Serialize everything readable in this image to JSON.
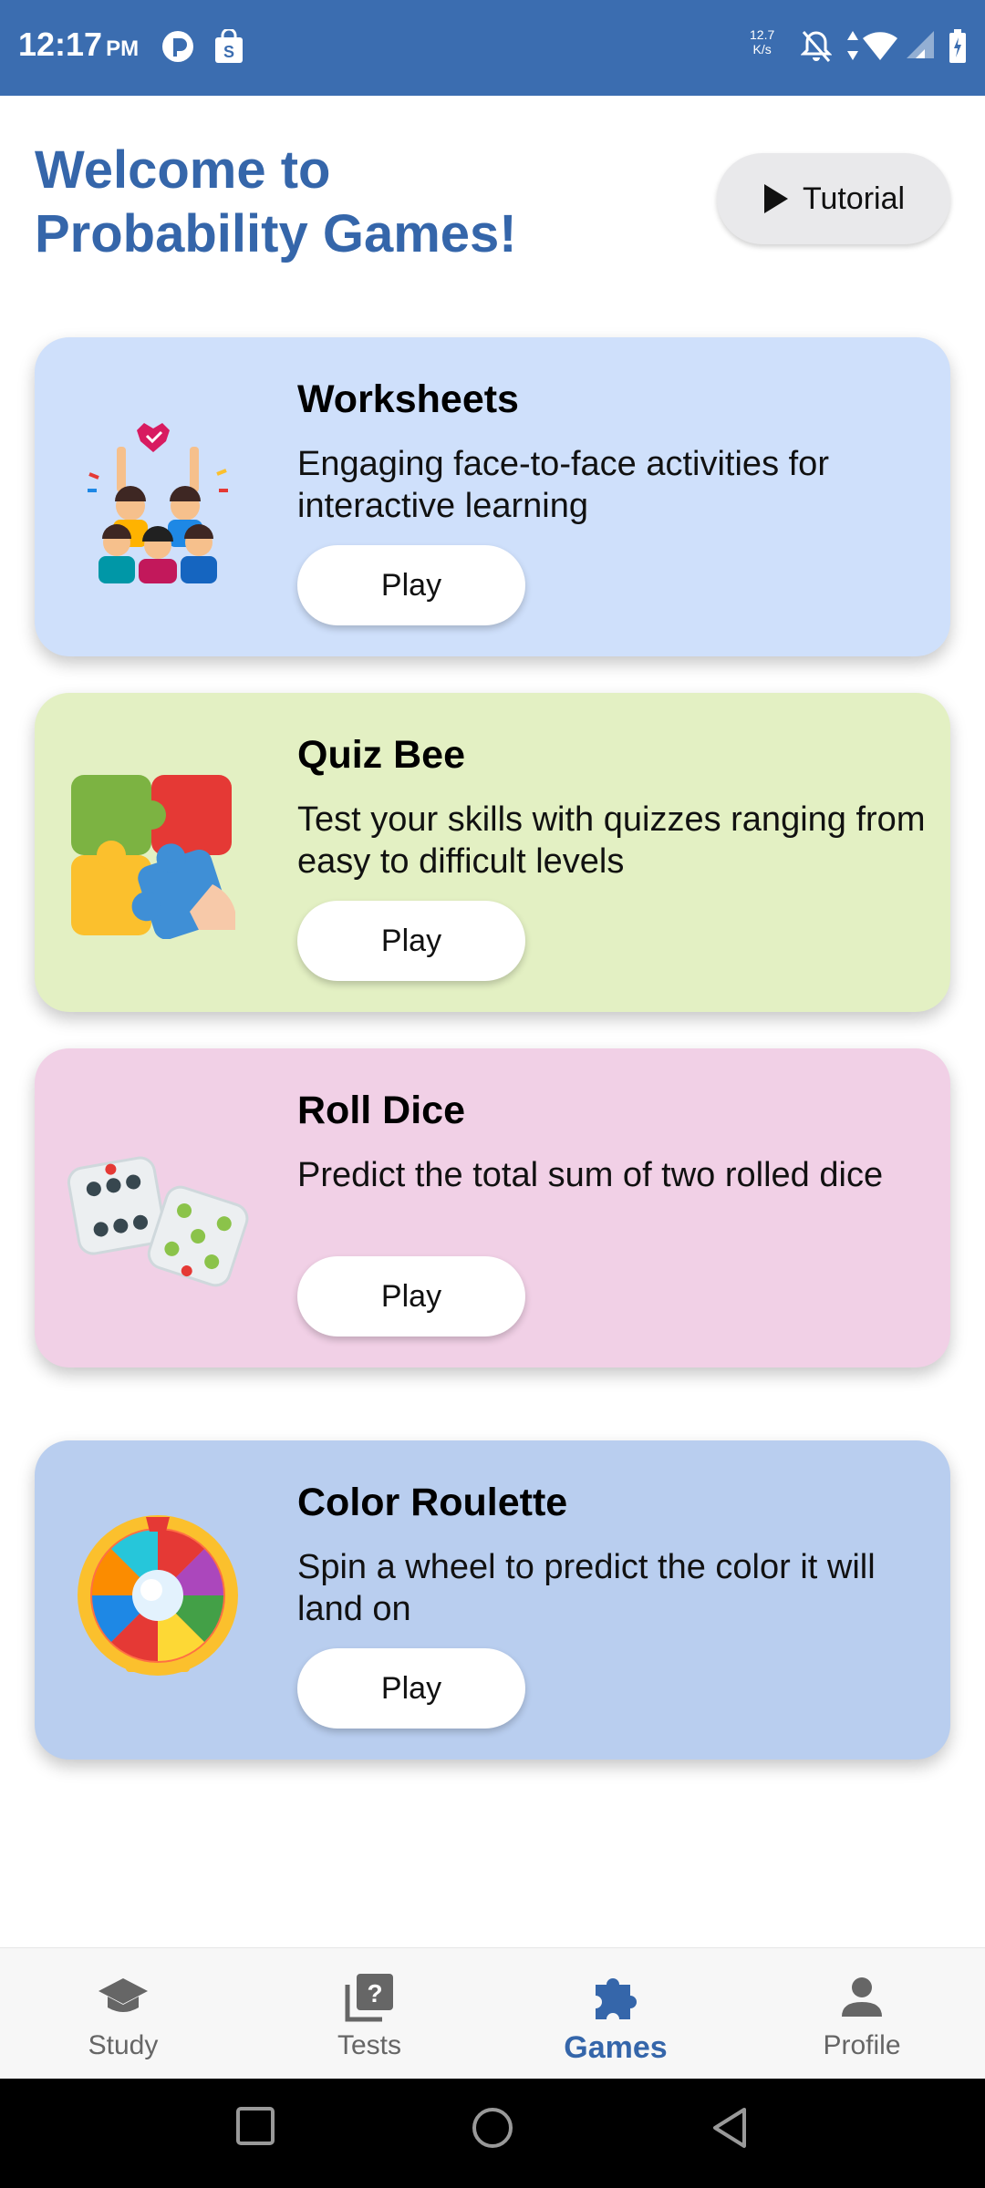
{
  "status_bar": {
    "time": "12:17",
    "ampm": "PM",
    "net_speed_value": "12.7",
    "net_speed_unit": "K/s",
    "icons": [
      "app-icon",
      "shopping-bag-icon",
      "notifications-off-icon",
      "data-arrows-icon",
      "wifi-icon",
      "signal-icon",
      "battery-icon"
    ]
  },
  "header": {
    "title_line1": "Welcome to",
    "title_line2": "Probability Games!",
    "tutorial_label": "Tutorial"
  },
  "games": [
    {
      "title": "Worksheets",
      "description": "Engaging face-to-face activities for interactive learning",
      "button": "Play",
      "bg": "#cfe0fb",
      "icon": "group-people-icon"
    },
    {
      "title": "Quiz Bee",
      "description": "Test your skills with quizzes ranging from easy to difficult levels",
      "button": "Play",
      "bg": "#e3f0c3",
      "icon": "puzzle-icon"
    },
    {
      "title": "Roll Dice",
      "description": "Predict the total sum of two rolled dice",
      "button": "Play",
      "bg": "#f1d0e6",
      "icon": "dice-icon"
    },
    {
      "title": "Color Roulette",
      "description": "Spin a wheel to predict the color it will land on",
      "button": "Play",
      "bg": "#b9ceef",
      "icon": "prize-wheel-icon"
    }
  ],
  "bottom_nav": {
    "items": [
      {
        "label": "Study",
        "icon": "graduation-cap-icon",
        "active": false
      },
      {
        "label": "Tests",
        "icon": "quiz-icon",
        "active": false
      },
      {
        "label": "Games",
        "icon": "puzzle-piece-icon",
        "active": true
      },
      {
        "label": "Profile",
        "icon": "person-icon",
        "active": false
      }
    ]
  },
  "colors": {
    "primary": "#3566aa",
    "status_bar": "#3b6db0"
  }
}
